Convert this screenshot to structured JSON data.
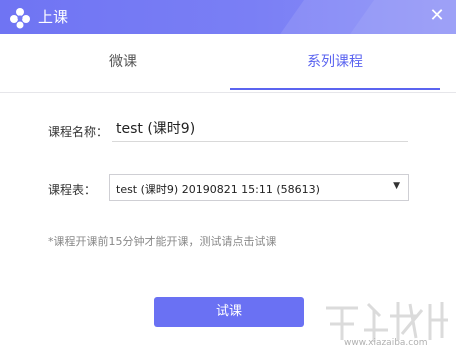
{
  "window": {
    "title": "上课",
    "close_glyph": "✕"
  },
  "tabs": [
    {
      "label": "微课",
      "active": false
    },
    {
      "label": "系列课程",
      "active": true
    }
  ],
  "form": {
    "course_name_label": "课程名称：",
    "course_name_value": "test (课时9)",
    "schedule_label": "课程表：",
    "schedule_selected": "test (课时9) 20190821 15:11 (58613)"
  },
  "note": "*课程开课前15分钟才能开课，测试请点击试课",
  "actions": {
    "try_label": "试课"
  },
  "watermark": {
    "text": "www.xiazaiba.com"
  },
  "colors": {
    "accent": "#5b64f0",
    "titlebar": "#7479f4",
    "button": "#6a71f3"
  }
}
